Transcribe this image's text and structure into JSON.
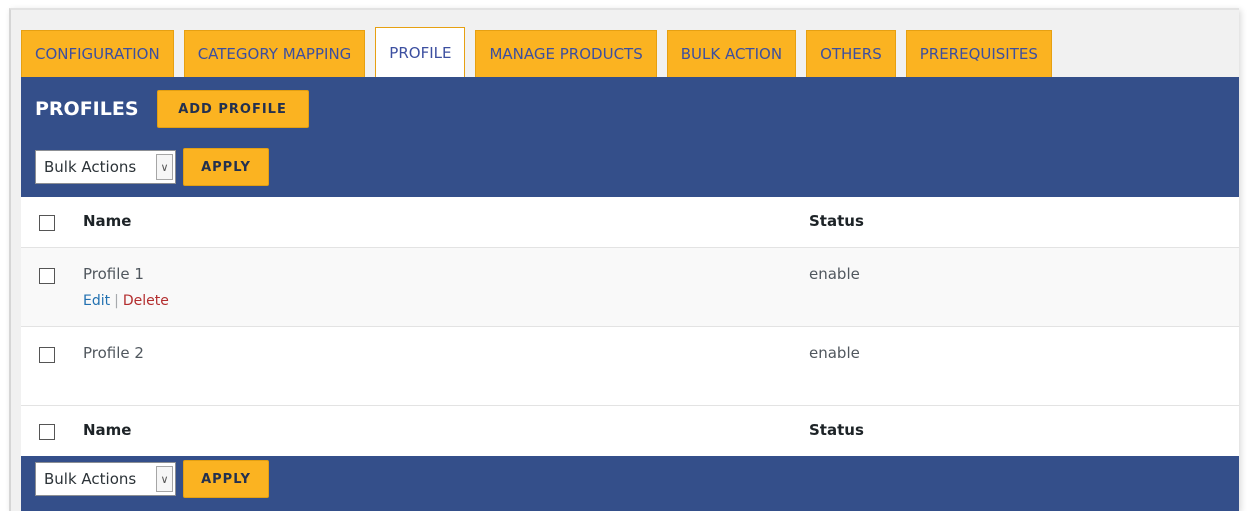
{
  "tabs": [
    {
      "label": "CONFIGURATION",
      "active": false
    },
    {
      "label": "CATEGORY MAPPING",
      "active": false
    },
    {
      "label": "PROFILE",
      "active": true
    },
    {
      "label": "MANAGE PRODUCTS",
      "active": false
    },
    {
      "label": "BULK ACTION",
      "active": false
    },
    {
      "label": "OTHERS",
      "active": false
    },
    {
      "label": "PREREQUISITES",
      "active": false
    }
  ],
  "page": {
    "title": "PROFILES",
    "add_button": "ADD PROFILE"
  },
  "bulk": {
    "select_value": "Bulk Actions",
    "apply_label": "APPLY"
  },
  "table": {
    "columns": {
      "name": "Name",
      "status": "Status"
    },
    "rows": [
      {
        "name": "Profile 1",
        "status": "enable"
      },
      {
        "name": "Profile 2",
        "status": "enable"
      }
    ],
    "row_actions": {
      "edit": "Edit",
      "separator": "|",
      "delete": "Delete"
    }
  },
  "colors": {
    "tab_bg": "#fbb321",
    "panel_bg": "#344f8a",
    "link_edit": "#2271b1",
    "link_delete": "#b32d2e"
  },
  "icons": {
    "select_caret": "chevron-down-icon",
    "checkbox": "checkbox-icon"
  }
}
